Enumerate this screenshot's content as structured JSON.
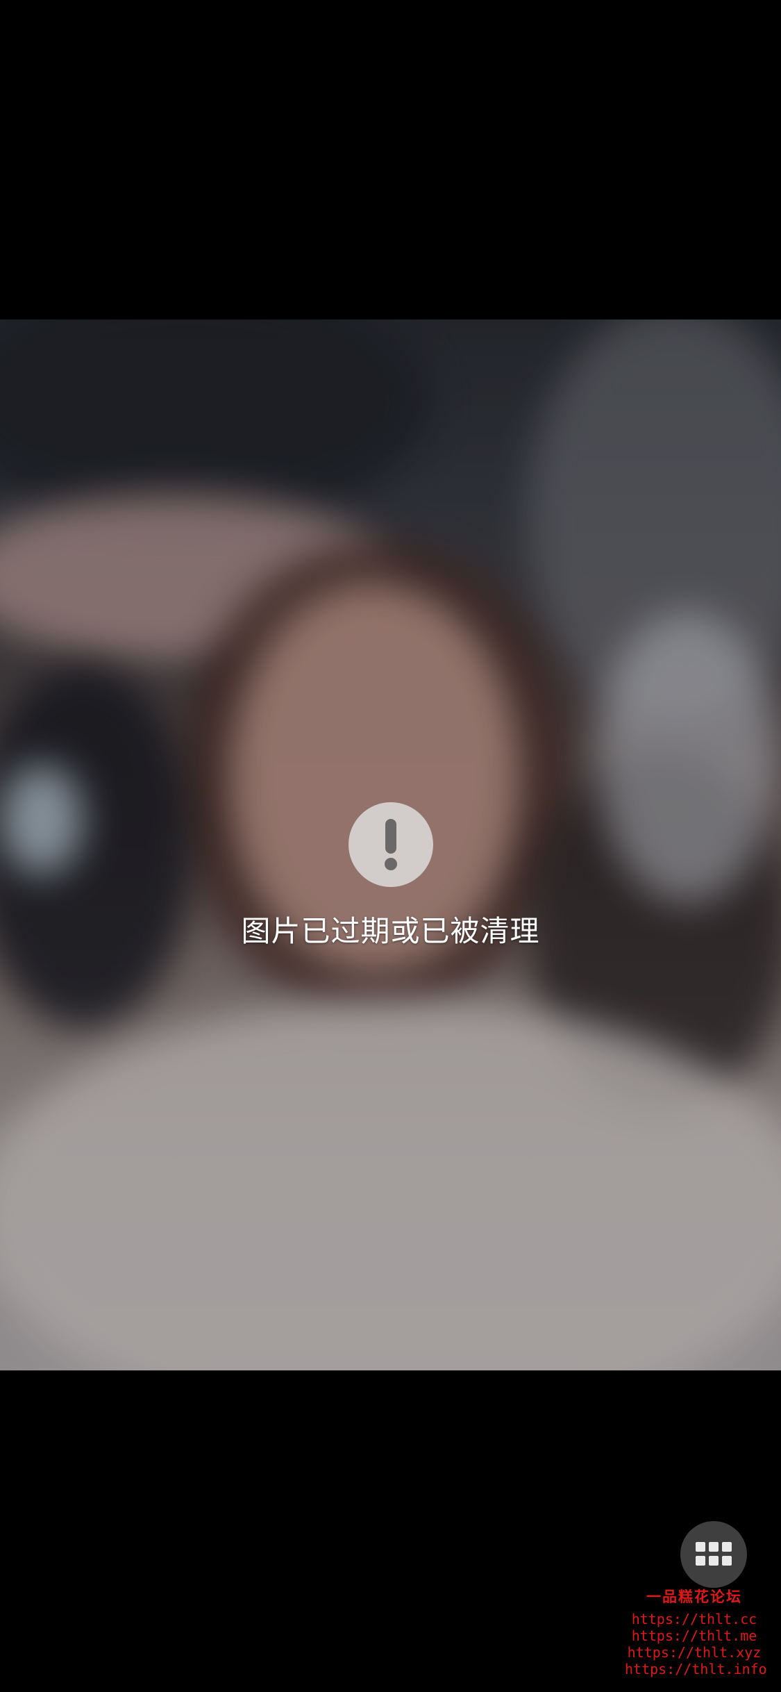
{
  "notice": {
    "icon": "exclamation-icon",
    "text": "图片已过期或已被清理"
  },
  "grid_button": {
    "icon": "grid-icon"
  },
  "watermark": {
    "title": "一品糕花论坛",
    "links": [
      "https://thlt.cc",
      "https://thlt.me",
      "https://thlt.xyz",
      "https://thlt.info"
    ]
  },
  "colors": {
    "background": "#000000",
    "notice_text": "#ffffff",
    "icon_circle": "#e1e1e1",
    "watermark": "#e01818",
    "grid_button": "#464646"
  }
}
